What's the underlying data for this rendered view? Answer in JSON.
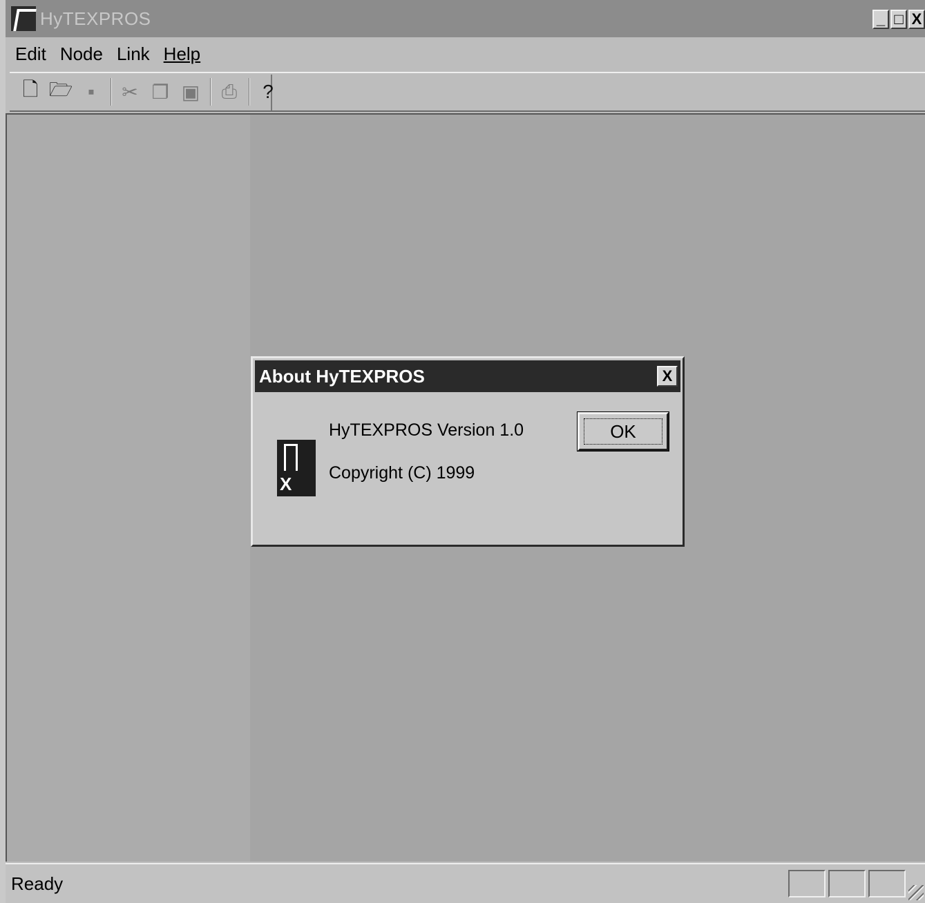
{
  "window": {
    "title": "HyTEXPROS",
    "controls": {
      "minimize": "_",
      "maximize": "□",
      "close": "X"
    }
  },
  "menu": {
    "items": [
      "Edit",
      "Node",
      "Link",
      "Help"
    ]
  },
  "toolbar": {
    "buttons": [
      {
        "icon": "new-document-icon",
        "glyph": "🗋",
        "enabled": true
      },
      {
        "icon": "open-folder-icon",
        "glyph": "🗁",
        "enabled": true
      },
      {
        "icon": "save-icon",
        "glyph": "▪",
        "enabled": false
      },
      {
        "icon": "cut-icon",
        "glyph": "✂",
        "enabled": false
      },
      {
        "icon": "copy-icon",
        "glyph": "❐",
        "enabled": false
      },
      {
        "icon": "paste-icon",
        "glyph": "▣",
        "enabled": false
      },
      {
        "icon": "print-icon",
        "glyph": "⎙",
        "enabled": false
      },
      {
        "icon": "help-icon",
        "glyph": "?",
        "enabled": true
      }
    ]
  },
  "dialog": {
    "title": "About HyTEXPROS",
    "close": "X",
    "version": "HyTEXPROS Version 1.0",
    "copyright": "Copyright (C) 1999",
    "ok_label": "OK"
  },
  "status": {
    "text": "Ready"
  }
}
